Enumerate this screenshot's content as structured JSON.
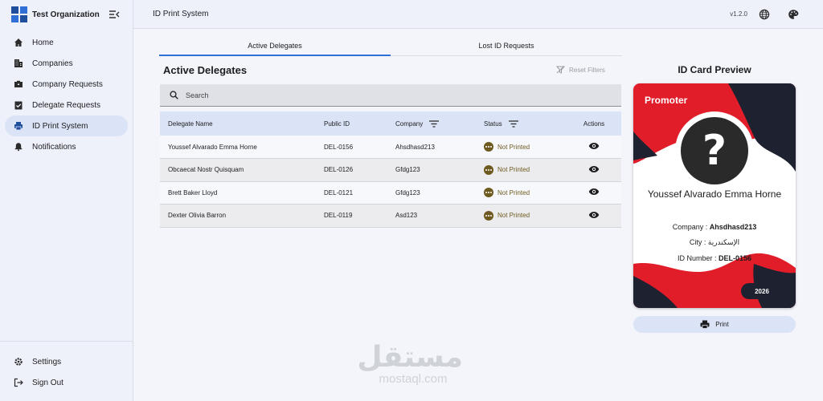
{
  "app": {
    "org_name": "Test Organization",
    "page_title": "ID Print System",
    "version": "v1.2.0"
  },
  "sidebar": {
    "items": [
      {
        "label": "Home",
        "icon": "home-icon"
      },
      {
        "label": "Companies",
        "icon": "building-icon"
      },
      {
        "label": "Company Requests",
        "icon": "briefcase-icon"
      },
      {
        "label": "Delegate Requests",
        "icon": "clipboard-check-icon"
      },
      {
        "label": "ID Print System",
        "icon": "printer-icon",
        "active": true
      },
      {
        "label": "Notifications",
        "icon": "bell-icon"
      }
    ],
    "bottom": [
      {
        "label": "Settings",
        "icon": "gear-icon"
      },
      {
        "label": "Sign Out",
        "icon": "sign-out-icon"
      }
    ]
  },
  "tabs": [
    "Active Delegates",
    "Lost ID Requests"
  ],
  "main": {
    "title": "Active Delegates",
    "reset_filters": "Reset Filters",
    "search_placeholder": "Search"
  },
  "table": {
    "columns": [
      "Delegate Name",
      "Public ID",
      "Company",
      "Status",
      "Actions"
    ],
    "rows": [
      {
        "name": "Youssef Alvarado Emma Horne",
        "public_id": "DEL-0156",
        "company": "Ahsdhasd213",
        "status": "Not Printed"
      },
      {
        "name": "Obcaecat Nostr Quisquam",
        "public_id": "DEL-0126",
        "company": "Gfdg123",
        "status": "Not Printed"
      },
      {
        "name": "Brett Baker Lloyd",
        "public_id": "DEL-0121",
        "company": "Gfdg123",
        "status": "Not Printed"
      },
      {
        "name": "Dexter Olivia Barron",
        "public_id": "DEL-0119",
        "company": "Asd123",
        "status": "Not Printed"
      }
    ]
  },
  "preview": {
    "title": "ID Card Preview",
    "role": "Promoter",
    "avatar_placeholder": "?",
    "name": "Youssef Alvarado Emma Horne",
    "company_label": "Company :",
    "company_value": "Ahsdhasd213",
    "city_label": "City :",
    "city_value": "الإسكندرية",
    "id_label": "ID Number :",
    "id_value": "DEL-0156",
    "year": "2026",
    "print_label": "Print"
  },
  "watermark": {
    "arabic": "مستقل",
    "latin": "mostaql.com"
  },
  "colors": {
    "accent": "#2f6fd6",
    "card_red": "#e11d2a",
    "card_dark": "#1d2130",
    "status": "#6d5a1e"
  }
}
